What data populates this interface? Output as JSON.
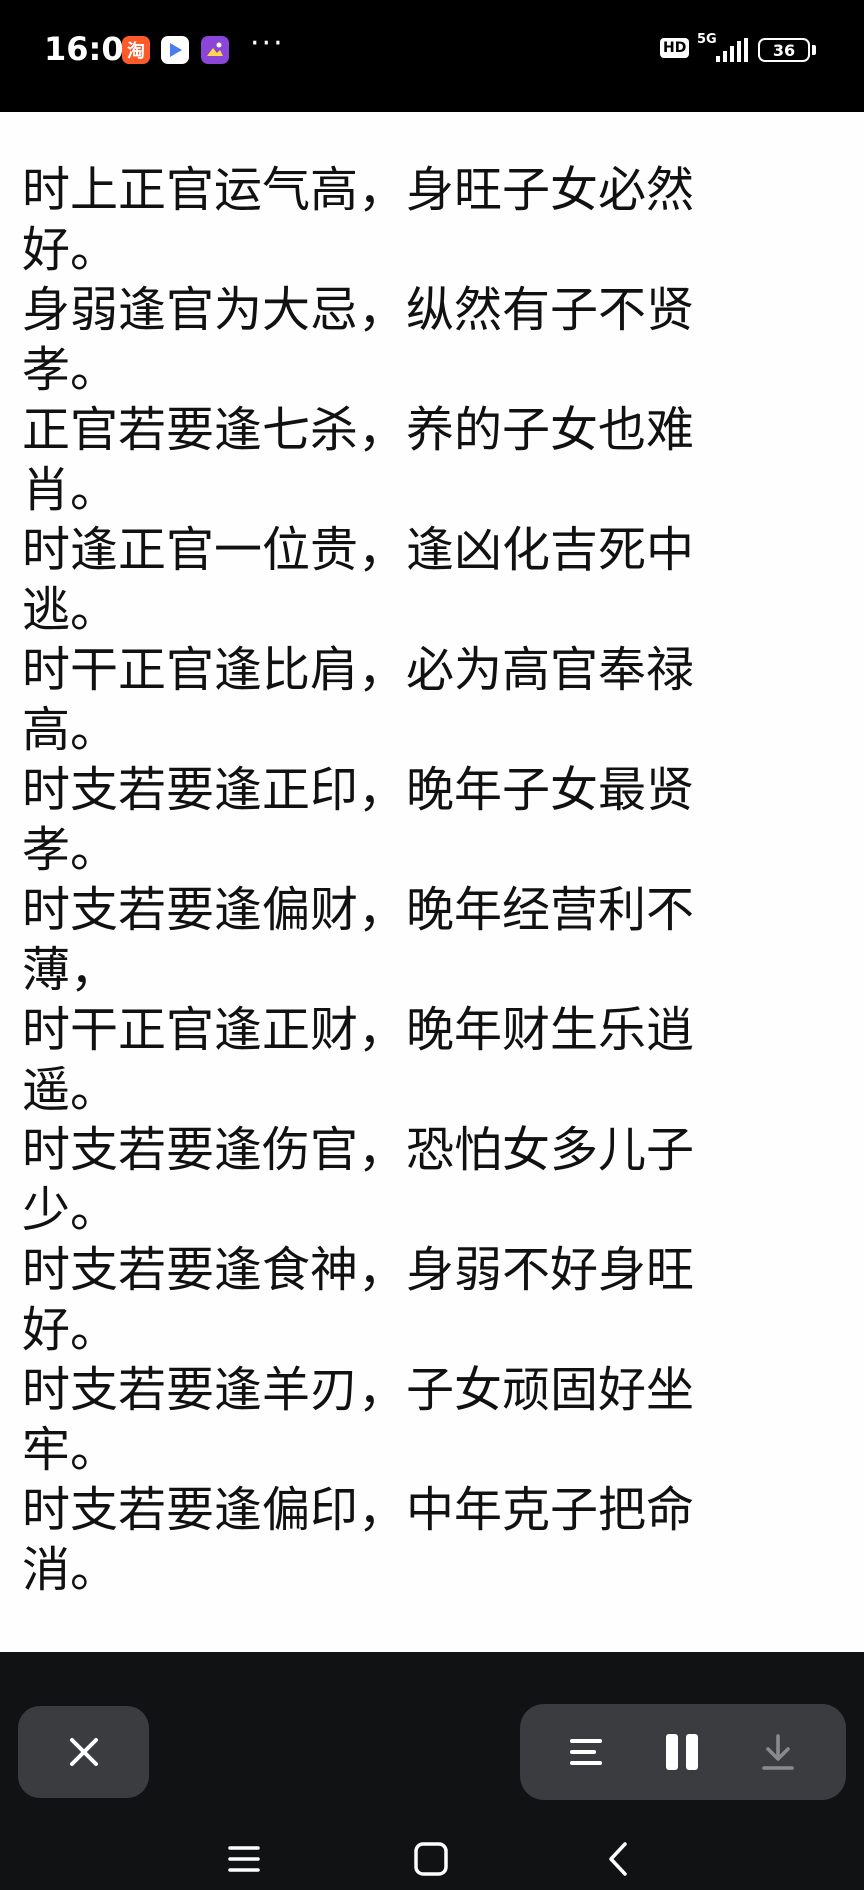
{
  "status_bar": {
    "time": "16:01",
    "taobao_icon_glyph": "淘",
    "more_dots": "···",
    "hd_label": "HD",
    "network_label": "5G",
    "battery_level": "36",
    "icons": [
      "taobao-app-icon",
      "video-app-icon",
      "gallery-app-icon",
      "signal-icon",
      "battery-icon"
    ]
  },
  "poem": {
    "lines": [
      "时上正官运气高，身旺子女必然好。",
      "身弱逢官为大忌，纵然有子不贤孝。",
      "正官若要逢七杀，养的子女也难肖。",
      "时逢正官一位贵，逢凶化吉死中逃。",
      "时干正官逢比肩，必为高官奉禄高。",
      "时支若要逢正印，晚年子女最贤孝。",
      "时支若要逢偏财，晚年经营利不薄，",
      "时干正官逢正财，晚年财生乐逍遥。",
      "时支若要逢伤官，恐怕女多儿子少。",
      "时支若要逢食神，身弱不好身旺好。",
      "时支若要逢羊刃，子女顽固好坐牢。",
      "时支若要逢偏印，中年克子把命消。"
    ]
  },
  "controls": {
    "close_icon": "close-icon",
    "menu_icon": "list-icon",
    "pause_icon": "pause-icon",
    "download_icon": "download-icon"
  },
  "nav": {
    "icons": [
      "recent-apps-icon",
      "home-icon",
      "back-icon"
    ]
  },
  "colors": {
    "background_top": "#000000",
    "content_bg": "#fefefe",
    "text": "#111111",
    "bottom_bar": "#111214",
    "button_bg": "#3b3c40"
  }
}
